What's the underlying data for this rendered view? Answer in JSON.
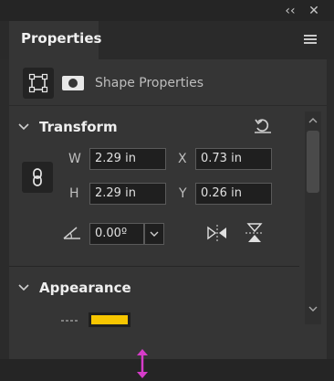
{
  "header": {
    "collapse_glyph": "‹‹",
    "close_glyph": "✕"
  },
  "tab": {
    "label": "Properties"
  },
  "shape": {
    "label": "Shape Properties"
  },
  "transform": {
    "title": "Transform",
    "w_label": "W",
    "w_value": "2.29 in",
    "x_label": "X",
    "x_value": "0.73 in",
    "h_label": "H",
    "h_value": "2.29 in",
    "y_label": "Y",
    "y_value": "0.26 in",
    "angle_value": "0.00º"
  },
  "appearance": {
    "title": "Appearance",
    "stroke_color": "#f7c600"
  },
  "colors": {
    "panel_bg": "#353535",
    "input_bg": "#1f1f1f",
    "accent_handle": "#d63cc9"
  }
}
